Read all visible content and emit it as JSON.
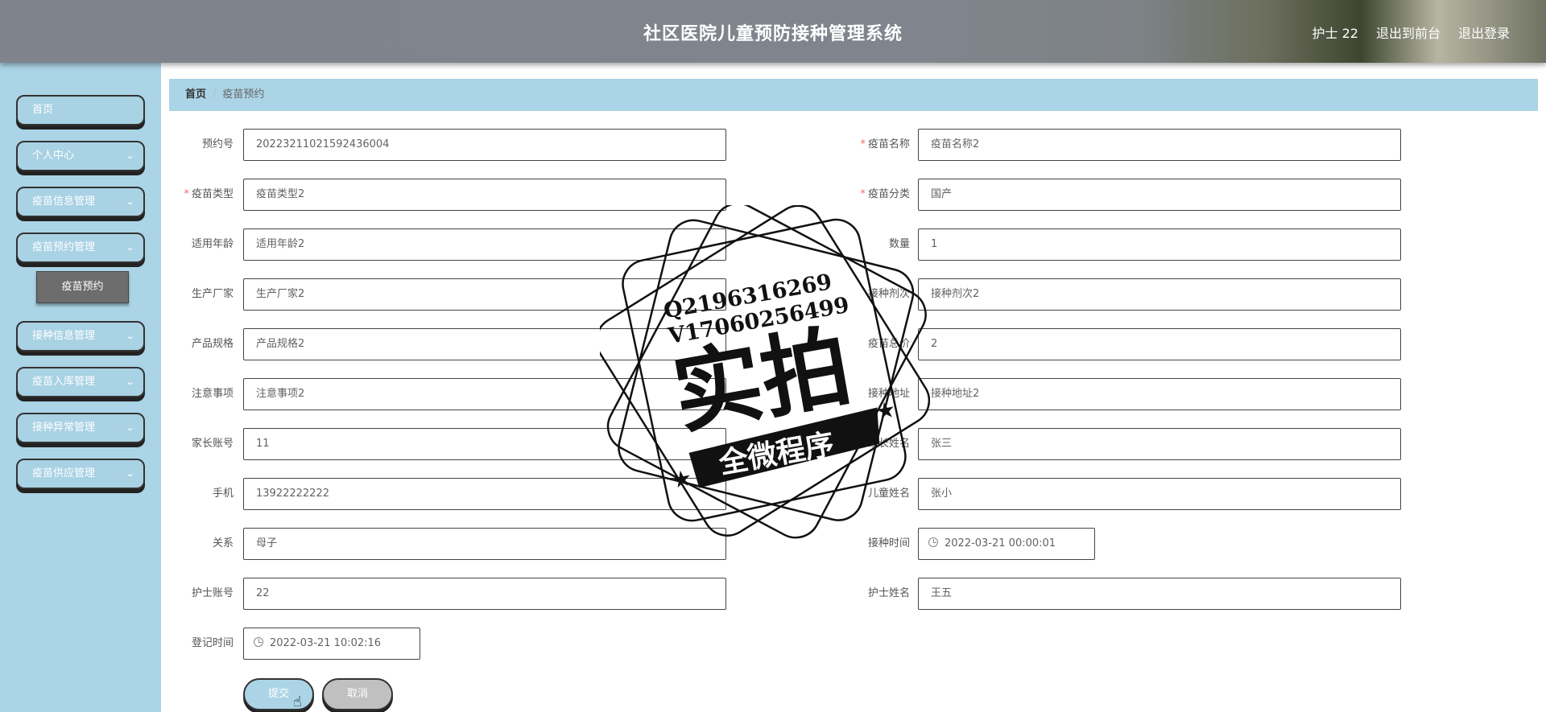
{
  "header": {
    "title": "社区医院儿童预防接种管理系统",
    "user_label": "护士 22",
    "front_link": "退出到前台",
    "logout_link": "退出登录"
  },
  "sidebar": {
    "items": [
      {
        "label": "首页",
        "has_children": false
      },
      {
        "label": "个人中心",
        "has_children": true
      },
      {
        "label": "疫苗信息管理",
        "has_children": true
      },
      {
        "label": "疫苗预约管理",
        "has_children": true
      },
      {
        "label": "接种信息管理",
        "has_children": true
      },
      {
        "label": "疫苗入库管理",
        "has_children": true
      },
      {
        "label": "接种异常管理",
        "has_children": true
      },
      {
        "label": "疫苗供应管理",
        "has_children": true
      }
    ],
    "active_submenu": "疫苗预约"
  },
  "breadcrumb": {
    "home": "首页",
    "current": "疫苗预约"
  },
  "form": {
    "left": [
      {
        "label": "预约号",
        "required": false,
        "value": "20223211021592436004"
      },
      {
        "label": "疫苗类型",
        "required": true,
        "value": "疫苗类型2"
      },
      {
        "label": "适用年龄",
        "required": false,
        "value": "适用年龄2"
      },
      {
        "label": "生产厂家",
        "required": false,
        "value": "生产厂家2"
      },
      {
        "label": "产品规格",
        "required": false,
        "value": "产品规格2"
      },
      {
        "label": "注意事项",
        "required": false,
        "value": "注意事项2"
      },
      {
        "label": "家长账号",
        "required": false,
        "value": "11"
      },
      {
        "label": "手机",
        "required": false,
        "value": "13922222222"
      },
      {
        "label": "关系",
        "required": false,
        "value": "母子"
      },
      {
        "label": "护士账号",
        "required": false,
        "value": "22"
      },
      {
        "label": "登记时间",
        "required": false,
        "value": "2022-03-21 10:02:16",
        "type": "datetime"
      }
    ],
    "right": [
      {
        "label": "疫苗名称",
        "required": true,
        "value": "疫苗名称2"
      },
      {
        "label": "疫苗分类",
        "required": true,
        "value": "国产"
      },
      {
        "label": "数量",
        "required": false,
        "value": "1"
      },
      {
        "label": "接种剂次",
        "required": false,
        "value": "接种剂次2"
      },
      {
        "label": "疫苗总价",
        "required": false,
        "value": "2"
      },
      {
        "label": "接种地址",
        "required": false,
        "value": "接种地址2"
      },
      {
        "label": "家长姓名",
        "required": false,
        "value": "张三"
      },
      {
        "label": "儿童姓名",
        "required": false,
        "value": "张小"
      },
      {
        "label": "接种时间",
        "required": false,
        "value": "2022-03-21 00:00:01",
        "type": "datetime"
      },
      {
        "label": "护士姓名",
        "required": false,
        "value": "王五"
      }
    ],
    "submit_label": "提交",
    "cancel_label": "取消"
  },
  "watermark": {
    "line1": "Q2196316269",
    "line2": "V17060256499",
    "main": "实拍",
    "banner": "全微程序"
  },
  "colors": {
    "sidebar_bg": "#abd4e6",
    "submenu_active": "#6d6d6d",
    "required_star": "#f56c6c"
  }
}
